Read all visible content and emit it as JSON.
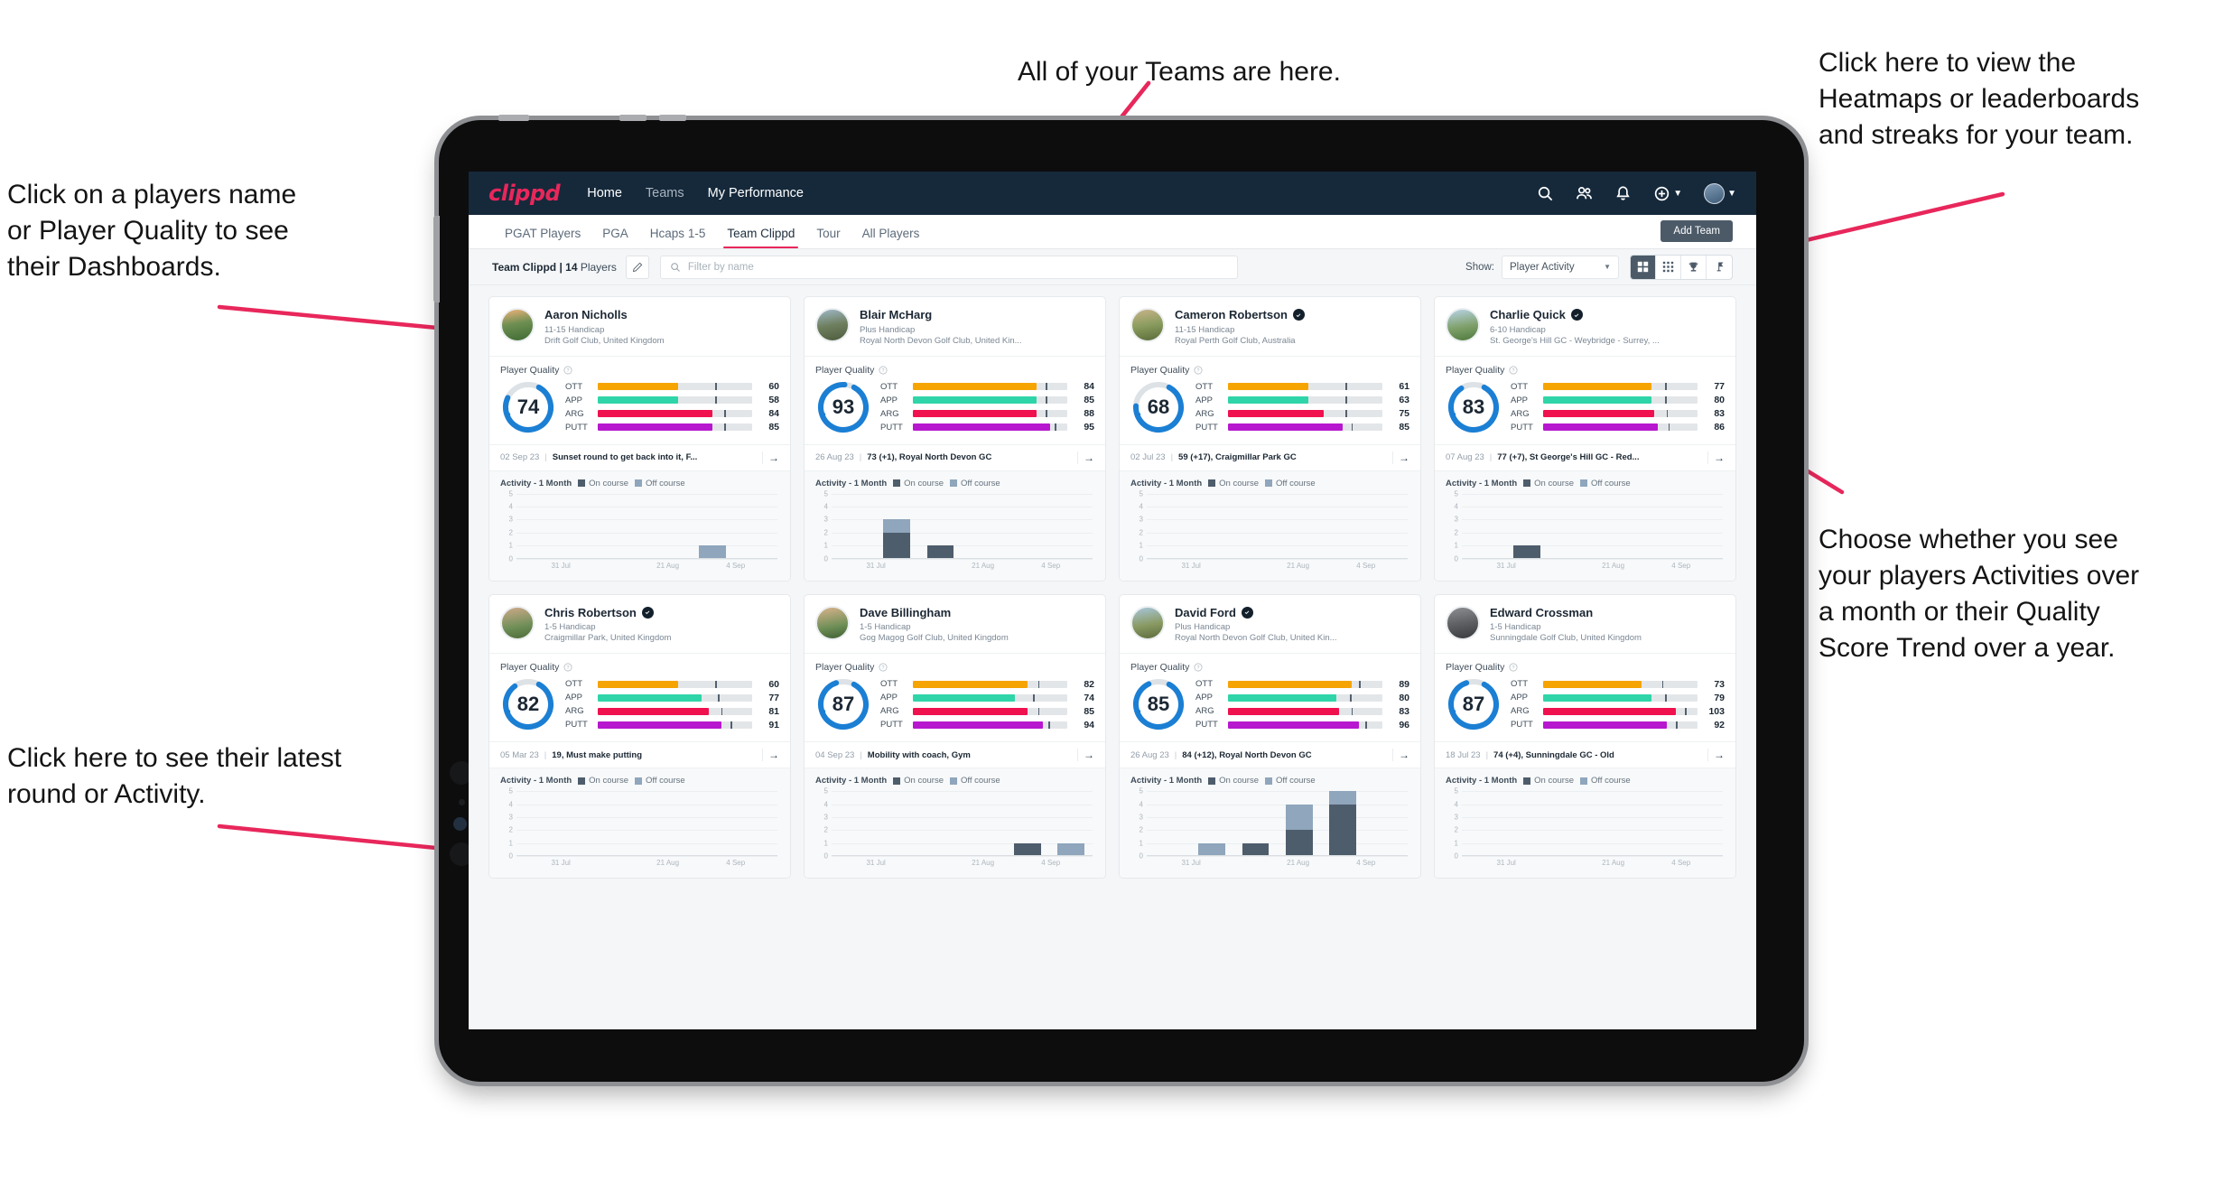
{
  "annotations": [
    {
      "id": "teams",
      "text": "All of your Teams are here."
    },
    {
      "id": "heatmaps",
      "text": "Click here to view the\nHeatmaps or leaderboards\nand streaks for your team."
    },
    {
      "id": "player-name",
      "text": "Click on a players name\nor Player Quality to see\ntheir Dashboards."
    },
    {
      "id": "activity-choice",
      "text": "Choose whether you see\nyour players Activities over\na month or their Quality\nScore Trend over a year."
    },
    {
      "id": "latest-round",
      "text": "Click here to see their latest\nround or Activity."
    }
  ],
  "app": {
    "logo": "clippd",
    "nav": [
      {
        "label": "Home",
        "active": true
      },
      {
        "label": "Teams",
        "active": false
      },
      {
        "label": "My Performance",
        "active": true
      }
    ],
    "nav_icons": [
      "search-icon",
      "people-icon",
      "bell-icon",
      "plus-circle-icon",
      "avatar"
    ],
    "tabs": [
      {
        "label": "PGAT Players",
        "active": false
      },
      {
        "label": "PGA",
        "active": false
      },
      {
        "label": "Hcaps 1-5",
        "active": false
      },
      {
        "label": "Team Clippd",
        "active": true
      },
      {
        "label": "Tour",
        "active": false
      },
      {
        "label": "All Players",
        "active": false
      }
    ],
    "add_team_label": "Add Team",
    "team_label_prefix": "Team Clippd | ",
    "team_count": "14",
    "team_label_suffix": " Players",
    "search_placeholder": "Filter by name",
    "show_label": "Show:",
    "show_value": "Player Activity",
    "view_buttons": [
      "grid-large-icon",
      "grid-small-icon",
      "trophy-icon",
      "flag-icon"
    ]
  },
  "colors": {
    "accent": "#e8275b",
    "navbar": "#15293b",
    "ring": "#1b7fd4",
    "ott": "#f5a400",
    "app": "#2fd5a8",
    "arg": "#f0114f",
    "putt": "#b717cf",
    "on_course": "#4e5d6c",
    "off_course": "#8fa6bc"
  },
  "card_labels": {
    "player_quality": "Player Quality",
    "activity": "Activity - 1 Month",
    "on_course": "On course",
    "off_course": "Off course",
    "metrics": [
      "OTT",
      "APP",
      "ARG",
      "PUTT"
    ],
    "y_ticks": [
      "5",
      "4",
      "3",
      "2",
      "1",
      "0"
    ],
    "x_ticks": [
      "31 Jul",
      "21 Aug",
      "4 Sep"
    ]
  },
  "players": [
    {
      "name": "Aaron Nicholls",
      "verified": false,
      "handicap": "11-15 Handicap",
      "club": "Drift Golf Club, United Kingdom",
      "avatar": "linear-gradient(170deg,#f0b27a 0%,#6e8f52 45%,#3f6b33 100%)",
      "quality": 74,
      "ring_pct": 74,
      "metrics": [
        {
          "name": "OTT",
          "value": 60,
          "fill": 52,
          "tick": 76
        },
        {
          "name": "APP",
          "value": 58,
          "fill": 52,
          "tick": 76
        },
        {
          "name": "ARG",
          "value": 84,
          "fill": 74,
          "tick": 82
        },
        {
          "name": "PUTT",
          "value": 85,
          "fill": 74,
          "tick": 82
        }
      ],
      "latest_date": "02 Sep 23",
      "latest_text": "Sunset round to get back into it, F...",
      "chart": {
        "on": [
          0,
          0,
          0,
          0,
          0,
          0
        ],
        "off": [
          0,
          0,
          0,
          0,
          1,
          0
        ]
      }
    },
    {
      "name": "Blair McHarg",
      "verified": false,
      "handicap": "Plus Handicap",
      "club": "Royal North Devon Golf Club, United Kin...",
      "avatar": "linear-gradient(170deg,#9fb8c9 0%,#6e7f5e 50%,#4d5c3e 100%)",
      "quality": 93,
      "ring_pct": 93,
      "metrics": [
        {
          "name": "OTT",
          "value": 84,
          "fill": 80,
          "tick": 86
        },
        {
          "name": "APP",
          "value": 85,
          "fill": 80,
          "tick": 86
        },
        {
          "name": "ARG",
          "value": 88,
          "fill": 80,
          "tick": 86
        },
        {
          "name": "PUTT",
          "value": 95,
          "fill": 89,
          "tick": 92
        }
      ],
      "latest_date": "26 Aug 23",
      "latest_text": "73 (+1), Royal North Devon GC",
      "chart": {
        "on": [
          0,
          2,
          1,
          0,
          0,
          0
        ],
        "off": [
          0,
          1,
          0,
          0,
          0,
          0
        ],
        "tall": [
          0,
          3,
          1,
          4,
          0,
          0
        ],
        "on2": [
          0,
          2,
          1,
          4,
          0,
          0
        ]
      }
    },
    {
      "name": "Cameron Robertson",
      "verified": true,
      "handicap": "11-15 Handicap",
      "club": "Royal Perth Golf Club, Australia",
      "avatar": "linear-gradient(170deg,#c9b48a 0%,#8a9c5e 50%,#5b6b3a 100%)",
      "quality": 68,
      "ring_pct": 68,
      "metrics": [
        {
          "name": "OTT",
          "value": 61,
          "fill": 52,
          "tick": 76
        },
        {
          "name": "APP",
          "value": 63,
          "fill": 52,
          "tick": 76
        },
        {
          "name": "ARG",
          "value": 75,
          "fill": 62,
          "tick": 76
        },
        {
          "name": "PUTT",
          "value": 85,
          "fill": 74,
          "tick": 80
        }
      ],
      "latest_date": "02 Jul 23",
      "latest_text": "59 (+17), Craigmillar Park GC",
      "chart": {
        "on": [
          0,
          0,
          0,
          0,
          0,
          0
        ],
        "off": [
          0,
          0,
          0,
          0,
          0,
          0
        ]
      }
    },
    {
      "name": "Charlie Quick",
      "verified": true,
      "handicap": "6-10 Handicap",
      "club": "St. George's Hill GC - Weybridge - Surrey, ...",
      "avatar": "linear-gradient(170deg,#b8d4e8 0%,#7fa06a 55%,#4e7a3e 100%)",
      "quality": 83,
      "ring_pct": 83,
      "metrics": [
        {
          "name": "OTT",
          "value": 77,
          "fill": 70,
          "tick": 79
        },
        {
          "name": "APP",
          "value": 80,
          "fill": 70,
          "tick": 79
        },
        {
          "name": "ARG",
          "value": 83,
          "fill": 72,
          "tick": 80
        },
        {
          "name": "PUTT",
          "value": 86,
          "fill": 74,
          "tick": 81
        }
      ],
      "latest_date": "07 Aug 23",
      "latest_text": "77 (+7), St George's Hill GC - Red...",
      "chart": {
        "on": [
          0,
          1,
          0,
          0,
          0,
          0
        ],
        "off": [
          0,
          0,
          0,
          0,
          0,
          0
        ]
      }
    },
    {
      "name": "Chris Robertson",
      "verified": true,
      "handicap": "1-5 Handicap",
      "club": "Craigmillar Park, United Kingdom",
      "avatar": "linear-gradient(170deg,#cfa98a 0%,#6f8f57 60%,#4d6b3a 100%)",
      "quality": 82,
      "ring_pct": 82,
      "metrics": [
        {
          "name": "OTT",
          "value": 60,
          "fill": 52,
          "tick": 76
        },
        {
          "name": "APP",
          "value": 77,
          "fill": 67,
          "tick": 78
        },
        {
          "name": "ARG",
          "value": 81,
          "fill": 72,
          "tick": 80
        },
        {
          "name": "PUTT",
          "value": 91,
          "fill": 80,
          "tick": 86
        }
      ],
      "latest_date": "05 Mar 23",
      "latest_text": "19, Must make putting",
      "chart": {
        "on": [
          0,
          0,
          0,
          0,
          0,
          0
        ],
        "off": [
          0,
          0,
          0,
          0,
          0,
          0
        ]
      }
    },
    {
      "name": "Dave Billingham",
      "verified": false,
      "handicap": "1-5 Handicap",
      "club": "Gog Magog Golf Club, United Kingdom",
      "avatar": "linear-gradient(170deg,#d9b38c 0%,#6f8f57 60%,#3f5e33 100%)",
      "quality": 87,
      "ring_pct": 87,
      "metrics": [
        {
          "name": "OTT",
          "value": 82,
          "fill": 74,
          "tick": 81
        },
        {
          "name": "APP",
          "value": 74,
          "fill": 66,
          "tick": 78
        },
        {
          "name": "ARG",
          "value": 85,
          "fill": 74,
          "tick": 81
        },
        {
          "name": "PUTT",
          "value": 94,
          "fill": 84,
          "tick": 88
        }
      ],
      "latest_date": "04 Sep 23",
      "latest_text": "Mobility with coach, Gym",
      "chart": {
        "on": [
          0,
          0,
          0,
          0,
          1,
          0
        ],
        "off": [
          0,
          0,
          0,
          0,
          0,
          1
        ]
      }
    },
    {
      "name": "David Ford",
      "verified": true,
      "handicap": "Plus Handicap",
      "club": "Royal North Devon Golf Club, United Kin...",
      "avatar": "linear-gradient(170deg,#a8c6dc 0%,#8a9a62 55%,#5c6b3c 100%)",
      "quality": 85,
      "ring_pct": 85,
      "metrics": [
        {
          "name": "OTT",
          "value": 89,
          "fill": 80,
          "tick": 85
        },
        {
          "name": "APP",
          "value": 80,
          "fill": 70,
          "tick": 79
        },
        {
          "name": "ARG",
          "value": 83,
          "fill": 72,
          "tick": 80
        },
        {
          "name": "PUTT",
          "value": 96,
          "fill": 85,
          "tick": 89
        }
      ],
      "latest_date": "26 Aug 23",
      "latest_text": "84 (+12), Royal North Devon GC",
      "chart": {
        "on": [
          0,
          0,
          1,
          2,
          4,
          0
        ],
        "off": [
          0,
          1,
          0,
          2,
          1,
          0
        ]
      }
    },
    {
      "name": "Edward Crossman",
      "verified": false,
      "handicap": "1-5 Handicap",
      "club": "Sunningdale Golf Club, United Kingdom",
      "avatar": "linear-gradient(170deg,#8d8f92 0%,#5e6063 50%,#383a3d 100%)",
      "quality": 87,
      "ring_pct": 87,
      "metrics": [
        {
          "name": "OTT",
          "value": 73,
          "fill": 64,
          "tick": 77
        },
        {
          "name": "APP",
          "value": 79,
          "fill": 70,
          "tick": 79
        },
        {
          "name": "ARG",
          "value": 103,
          "fill": 86,
          "tick": 92
        },
        {
          "name": "PUTT",
          "value": 92,
          "fill": 80,
          "tick": 86
        }
      ],
      "latest_date": "18 Jul 23",
      "latest_text": "74 (+4), Sunningdale GC - Old",
      "chart": {
        "on": [
          0,
          0,
          0,
          0,
          0,
          0
        ],
        "off": [
          0,
          0,
          0,
          0,
          0,
          0
        ]
      }
    }
  ]
}
